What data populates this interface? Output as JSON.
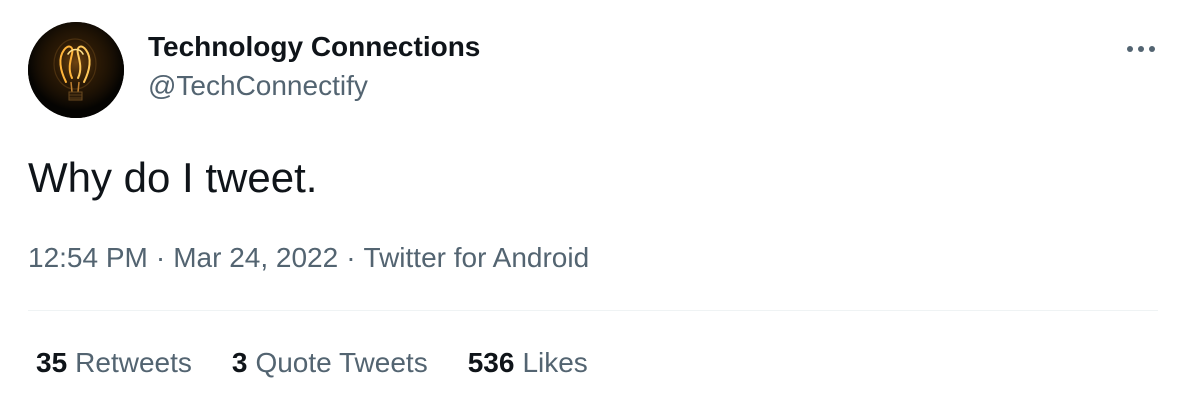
{
  "author": {
    "display_name": "Technology Connections",
    "handle": "@TechConnectify",
    "avatar_icon": "lightbulb-filament-icon"
  },
  "menu": {
    "icon": "more-horizontal-icon"
  },
  "tweet": {
    "text": "Why do I tweet.",
    "time": "12:54 PM",
    "date": "Mar 24, 2022",
    "source": "Twitter for Android",
    "separator": "·"
  },
  "stats": {
    "retweets": {
      "count": "35",
      "label": "Retweets"
    },
    "quote_tweets": {
      "count": "3",
      "label": "Quote Tweets"
    },
    "likes": {
      "count": "536",
      "label": "Likes"
    }
  },
  "colors": {
    "text_primary": "#0f1419",
    "text_secondary": "#536471",
    "divider": "#eff3f4"
  }
}
